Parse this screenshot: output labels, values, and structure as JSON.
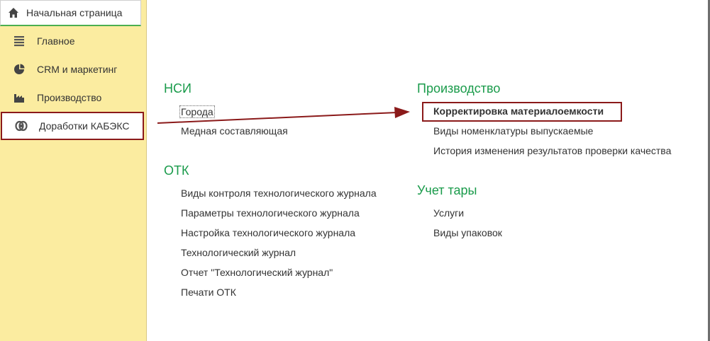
{
  "home_tab": {
    "label": "Начальная страница",
    "icon": "home-icon"
  },
  "sections": [
    {
      "label": "Главное",
      "icon": "menu-lines-icon"
    },
    {
      "label": "CRM и маркетинг",
      "icon": "pie-chart-icon"
    },
    {
      "label": "Производство",
      "icon": "factory-icon"
    },
    {
      "label": "Доработки КАБЭКС",
      "icon": "gears-icon",
      "selected": true
    }
  ],
  "groups": {
    "nsi": {
      "title": "НСИ",
      "items": [
        "Города",
        "Медная составляющая"
      ]
    },
    "otk": {
      "title": "ОТК",
      "items": [
        "Виды контроля технологического журнала",
        "Параметры технологического журнала",
        "Настройка технологического журнала",
        "Технологический журнал",
        "Отчет \"Технологический журнал\"",
        "Печати ОТК"
      ]
    },
    "proizvodstvo": {
      "title": "Производство",
      "items": [
        "Корректировка материалоемкости",
        "Виды номенклатуры выпускаемые",
        "История изменения результатов проверки качества"
      ]
    },
    "uchet_tary": {
      "title": "Учет тары",
      "items": [
        "Услуги",
        "Виды упаковок"
      ]
    }
  },
  "colors": {
    "panel_bg": "#fbeca0",
    "group_title": "#1a9b4b",
    "highlight": "#8b1a1a",
    "tab_underline": "#4caf50"
  }
}
